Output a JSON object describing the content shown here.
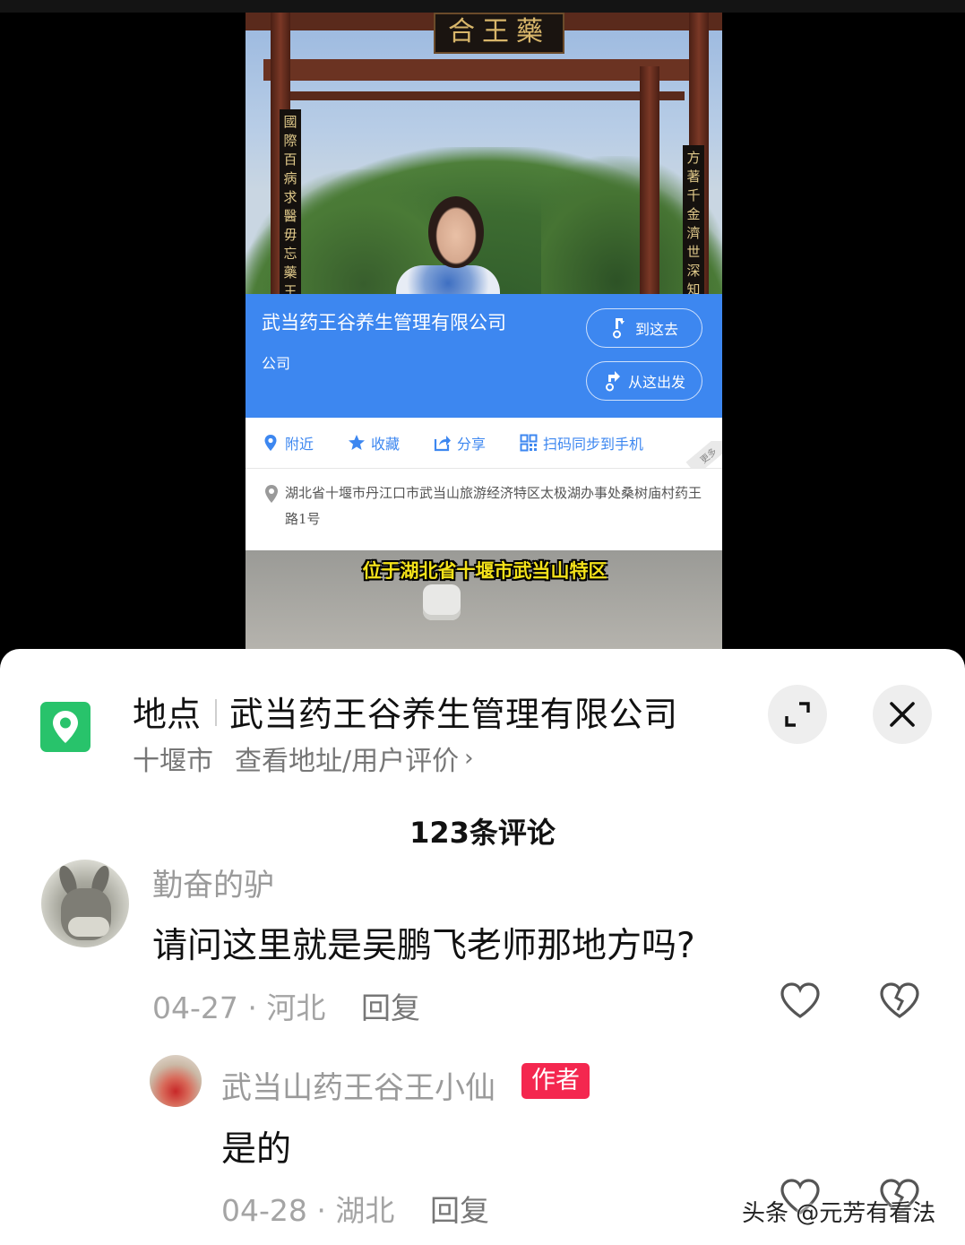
{
  "video": {
    "gate_sign": "合王藥",
    "couplet_left": "國際百病求醫毋忘藥王",
    "couplet_right": "方著千金濟世深知人命",
    "subtitle": "位于湖北省十堰市武当山特区"
  },
  "map_card": {
    "poi_name": "武当药王谷养生管理有限公司",
    "poi_type": "公司",
    "go_here_label": "到这去",
    "start_here_label": "从这出发",
    "actions": [
      {
        "label": "附近",
        "icon": "location-pin-icon"
      },
      {
        "label": "收藏",
        "icon": "star-icon"
      },
      {
        "label": "分享",
        "icon": "share-icon"
      },
      {
        "label": "扫码同步到手机",
        "icon": "qr-code-icon"
      }
    ],
    "more_label": "更多",
    "address": "湖北省十堰市丹江口市武当山旅游经济特区太极湖办事处桑树庙村药王路1号"
  },
  "location_bar": {
    "label": "地点",
    "name": "武当药王谷养生管理有限公司",
    "city": "十堰市",
    "link_text": "查看地址/用户评价",
    "chevron": "›"
  },
  "comments": {
    "count_text": "123条评论",
    "items": [
      {
        "user": "勤奋的驴",
        "text": "请问这里就是吴鹏飞老师那地方吗?",
        "meta": "04-27 · 河北",
        "reply": "回复"
      },
      {
        "user": "武当山药王谷王小仙",
        "badge": "作者",
        "text": "是的",
        "meta": "04-28 · 湖北",
        "reply": "回复"
      }
    ]
  },
  "watermark": "头条 @元芳有看法",
  "colors": {
    "map_blue": "#3d87f0",
    "location_green": "#28c36b",
    "author_badge": "#f4274f",
    "subtitle_yellow": "#f4e21a"
  }
}
